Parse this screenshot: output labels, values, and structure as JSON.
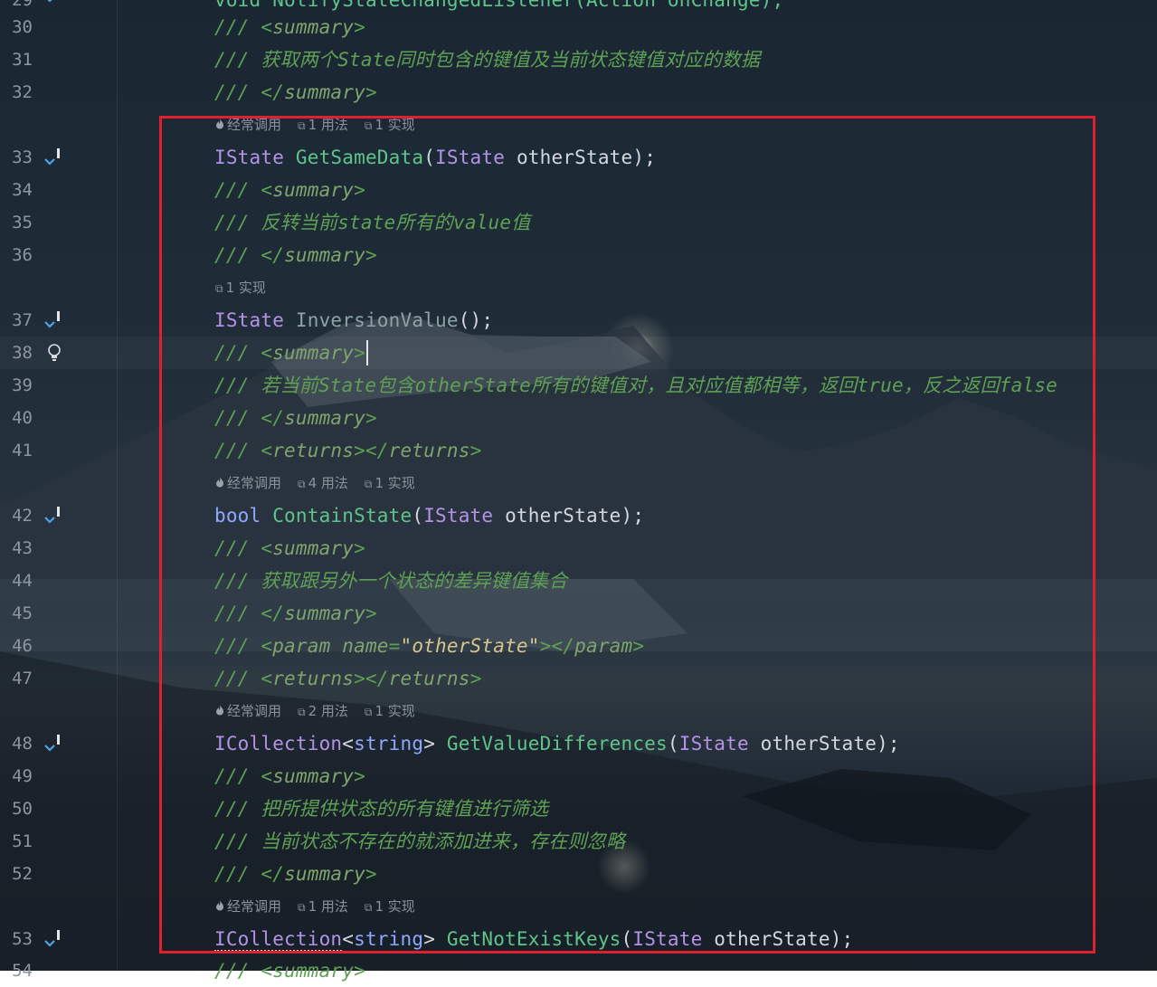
{
  "editor": {
    "top_partial": {
      "line": "29",
      "text": "void NotifyStateChangedListener(Action onChange);"
    },
    "bottom_partial": {
      "line": "54",
      "text": "/// <summary>"
    },
    "lines": [
      {
        "n": "30",
        "slash": "///",
        "open": "<",
        "tag": "summary",
        "close": ">"
      },
      {
        "n": "31",
        "slash": "///",
        "text": "获取两个State同时包含的键值及当前状态键值对应的数据"
      },
      {
        "n": "32",
        "slash": "///",
        "open": "</",
        "tag": "summary",
        "close": ">"
      },
      {
        "n": "33",
        "type": "IState",
        "fn": "GetSameData",
        "p1": "(",
        "ptype": "IState",
        "pname": "otherState",
        "end": ");"
      },
      {
        "n": "34",
        "slash": "///",
        "open": "<",
        "tag": "summary",
        "close": ">"
      },
      {
        "n": "35",
        "slash": "///",
        "text": "反转当前state所有的value值"
      },
      {
        "n": "36",
        "slash": "///",
        "open": "</",
        "tag": "summary",
        "close": ">"
      },
      {
        "n": "37",
        "type": "IState",
        "fn": "InversionValue",
        "end": "();"
      },
      {
        "n": "38",
        "slash": "///",
        "open": "<",
        "tag": "summary",
        "close": ">"
      },
      {
        "n": "39",
        "slash": "///",
        "text": "若当前State包含otherState所有的键值对，且对应值都相等，返回true，反之返回false"
      },
      {
        "n": "40",
        "slash": "///",
        "open": "</",
        "tag": "summary",
        "close": ">"
      },
      {
        "n": "41",
        "slash": "///",
        "open": "<",
        "tag": "returns",
        "mid": "></",
        "tag2": "returns",
        "close": ">"
      },
      {
        "n": "42",
        "type": "bool",
        "fn": "ContainState",
        "p1": "(",
        "ptype": "IState",
        "pname": "otherState",
        "end": ");"
      },
      {
        "n": "43",
        "slash": "///",
        "open": "<",
        "tag": "summary",
        "close": ">"
      },
      {
        "n": "44",
        "slash": "///",
        "text": "获取跟另外一个状态的差异键值集合"
      },
      {
        "n": "45",
        "slash": "///",
        "open": "</",
        "tag": "summary",
        "close": ">"
      },
      {
        "n": "46",
        "slash": "///",
        "open": "<",
        "tag": "param",
        "attr": "name",
        "eq": "=",
        "val": "\"otherState\"",
        "mid": "></",
        "tag2": "param",
        "close": ">"
      },
      {
        "n": "47",
        "slash": "///",
        "open": "<",
        "tag": "returns",
        "mid": "></",
        "tag2": "returns",
        "close": ">"
      },
      {
        "n": "48",
        "type": "ICollection",
        "lt": "<",
        "targ": "string",
        "gt": ">",
        "fn": "GetValueDifferences",
        "p1": "(",
        "ptype": "IState",
        "pname": "otherState",
        "end": ");"
      },
      {
        "n": "49",
        "slash": "///",
        "open": "<",
        "tag": "summary",
        "close": ">"
      },
      {
        "n": "50",
        "slash": "///",
        "text": "把所提供状态的所有键值进行筛选"
      },
      {
        "n": "51",
        "slash": "///",
        "text": "当前状态不存在的就添加进来，存在则忽略"
      },
      {
        "n": "52",
        "slash": "///",
        "open": "</",
        "tag": "summary",
        "close": ">"
      },
      {
        "n": "53",
        "type": "ICollection",
        "lt": "<",
        "targ": "string",
        "gt": ">",
        "fn": "GetNotExistKeys",
        "p1": "(",
        "ptype": "IState",
        "pname": "otherState",
        "end": ");"
      }
    ],
    "hints": [
      {
        "before_line": "33",
        "items": [
          "经常调用",
          "1 用法",
          "1 实现"
        ]
      },
      {
        "before_line": "37",
        "items": [
          "1 实现"
        ]
      },
      {
        "before_line": "42",
        "items": [
          "经常调用",
          "4 用法",
          "1 实现"
        ]
      },
      {
        "before_line": "48",
        "items": [
          "经常调用",
          "2 用法",
          "1 实现"
        ]
      },
      {
        "before_line": "53",
        "items": [
          "经常调用",
          "1 用法",
          "1 实现"
        ]
      }
    ]
  },
  "colors": {
    "highlight_box": "#e0202c",
    "comment": "#5fa055",
    "keyword": "#8fa8ff",
    "type": "#b492e6",
    "function": "#5fc48a"
  }
}
